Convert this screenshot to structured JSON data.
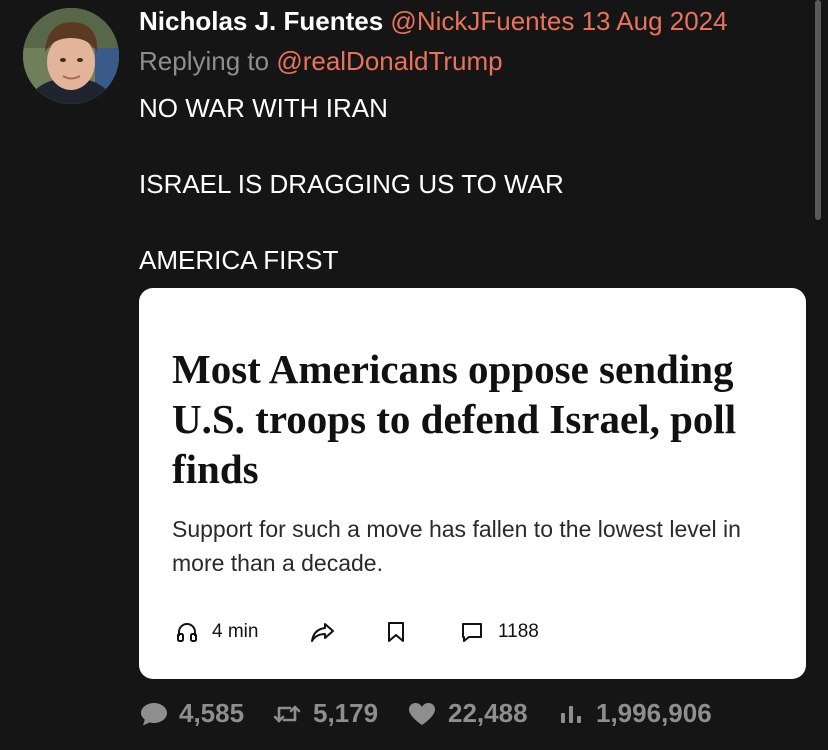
{
  "tweet": {
    "author_name": "Nicholas J. Fuentes",
    "handle": "@NickJFuentes",
    "date": "13 Aug 2024",
    "replying_prefix": "Replying to",
    "replying_to": "@realDonaldTrump",
    "lines": [
      "NO WAR WITH IRAN",
      "ISRAEL IS DRAGGING US TO WAR",
      "AMERICA FIRST"
    ]
  },
  "card": {
    "headline": "Most Americans oppose sending U.S. troops to defend Israel, poll finds",
    "subhead": "Support for such a move has fallen to the lowest level in more than a decade.",
    "listen_label": "4 min",
    "comments_count": "1188",
    "icons": [
      "headphones-icon",
      "share-icon",
      "bookmark-icon",
      "comment-icon"
    ]
  },
  "stats": {
    "replies": "4,585",
    "retweets": "5,179",
    "likes": "22,488",
    "views": "1,996,906"
  },
  "colors": {
    "background": "#151515",
    "accent": "#e8735a",
    "muted": "#8e8e8e",
    "card": "#ffffff"
  }
}
